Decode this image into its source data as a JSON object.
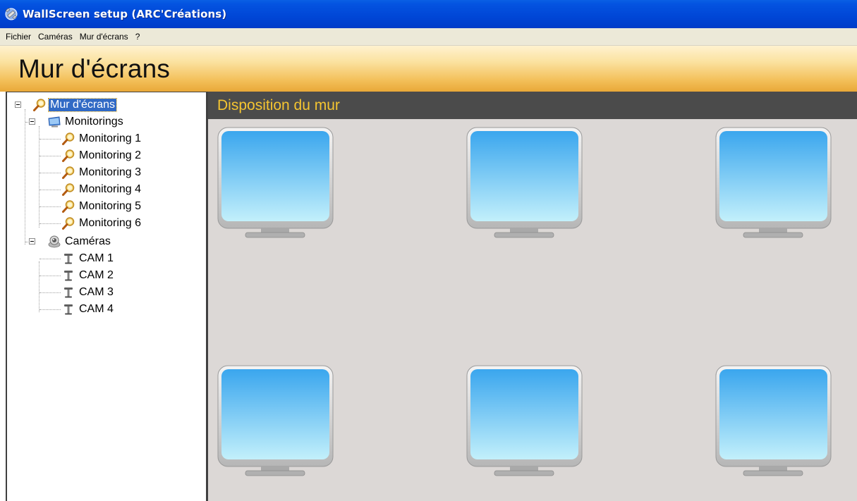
{
  "window": {
    "title": "WallScreen setup (ARC'Créations)",
    "app_icon": "satellite-icon"
  },
  "menu": [
    "Fichier",
    "Caméras",
    "Mur d'écrans",
    "?"
  ],
  "header": {
    "title": "Mur d'écrans"
  },
  "tree": {
    "root": {
      "label": "Mur d'écrans",
      "icon": "magnifier-icon",
      "selected": true
    },
    "monitorings": {
      "label": "Monitorings",
      "icon": "monitor-icon",
      "items": [
        "Monitoring 1",
        "Monitoring 2",
        "Monitoring 3",
        "Monitoring 4",
        "Monitoring 5",
        "Monitoring 6"
      ]
    },
    "cameras": {
      "label": "Caméras",
      "icon": "webcam-icon",
      "items": [
        "CAM 1",
        "CAM 2",
        "CAM 3",
        "CAM 4"
      ]
    }
  },
  "wall": {
    "title": "Disposition du mur",
    "screens": 6
  },
  "colors": {
    "titlebar": "#0046d6",
    "selection": "#316ac5",
    "wall_title": "#f5c531",
    "wall_bg": "#dcd8d6"
  }
}
